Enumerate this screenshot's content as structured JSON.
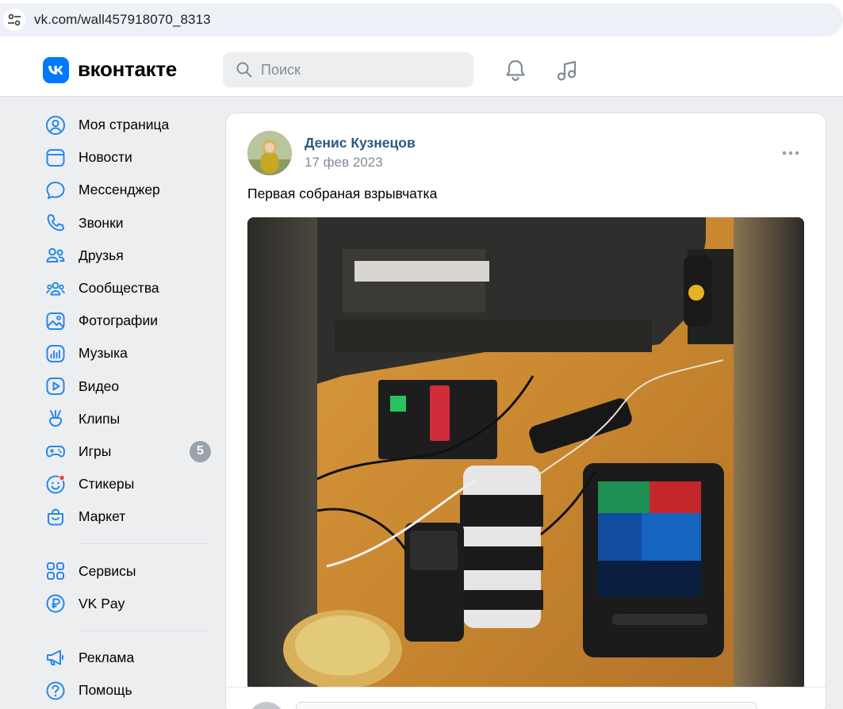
{
  "browser": {
    "url": "vk.com/wall457918070_8313",
    "tune_icon": "page-info-icon"
  },
  "header": {
    "brand": "вконтакте",
    "search_placeholder": "Поиск",
    "icons": [
      "bell-icon",
      "music-note-icon"
    ],
    "accent": "#0077ff"
  },
  "sidebar": {
    "items": [
      {
        "label": "Моя страница",
        "icon": "user-circle-icon"
      },
      {
        "label": "Новости",
        "icon": "news-icon"
      },
      {
        "label": "Мессенджер",
        "icon": "message-bubble-icon"
      },
      {
        "label": "Звонки",
        "icon": "phone-icon"
      },
      {
        "label": "Друзья",
        "icon": "friends-icon"
      },
      {
        "label": "Сообщества",
        "icon": "communities-icon"
      },
      {
        "label": "Фотографии",
        "icon": "photo-icon"
      },
      {
        "label": "Музыка",
        "icon": "music-icon"
      },
      {
        "label": "Видео",
        "icon": "video-icon"
      },
      {
        "label": "Клипы",
        "icon": "clips-icon"
      },
      {
        "label": "Игры",
        "icon": "gamepad-icon",
        "badge": "5"
      },
      {
        "label": "Стикеры",
        "icon": "sticker-icon"
      },
      {
        "label": "Маркет",
        "icon": "market-bag-icon"
      }
    ],
    "items2": [
      {
        "label": "Сервисы",
        "icon": "services-grid-icon"
      },
      {
        "label": "VK Pay",
        "icon": "vkpay-icon"
      }
    ],
    "items3": [
      {
        "label": "Реклама",
        "icon": "megaphone-icon"
      },
      {
        "label": "Помощь",
        "icon": "help-icon"
      }
    ],
    "icon_color": "#2688eb",
    "badge_color": "#99a2ad"
  },
  "post": {
    "author": "Денис Кузнецов",
    "date": "17 фев 2023",
    "text": "Первая собраная взрывчатка",
    "more_icon": "more-dots-icon",
    "author_color": "#2a5885"
  }
}
